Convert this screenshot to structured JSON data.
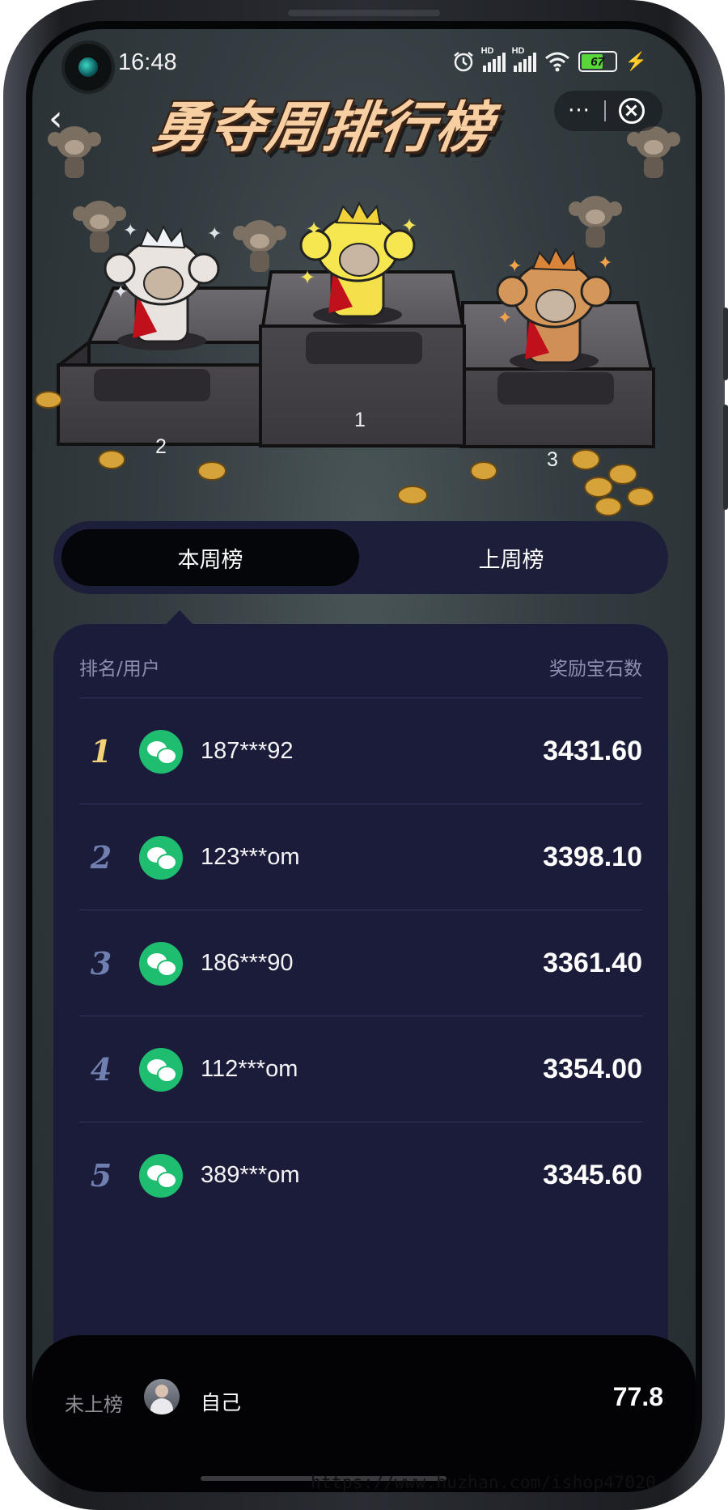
{
  "status_bar": {
    "time": "16:48",
    "hd_label": "HD",
    "battery": "67",
    "icons": [
      "alarm-icon",
      "signal-icon",
      "signal-icon",
      "wifi-icon",
      "battery-icon",
      "charging-icon"
    ]
  },
  "header": {
    "title": "勇夺周排行榜",
    "more_label": "···",
    "back_icon": "‹"
  },
  "podium": {
    "ranks": [
      {
        "label": "2",
        "medal": "silver"
      },
      {
        "label": "1",
        "medal": "gold"
      },
      {
        "label": "3",
        "medal": "bronze"
      }
    ]
  },
  "tabs": {
    "this_week": "本周榜",
    "last_week": "上周榜",
    "active": "this_week"
  },
  "list": {
    "col_rank_user": "排名/用户",
    "col_reward": "奖励宝石数",
    "rows": [
      {
        "rank": "1",
        "user": "187***92",
        "amount": "3431.60"
      },
      {
        "rank": "2",
        "user": "123***om",
        "amount": "3398.10"
      },
      {
        "rank": "3",
        "user": "186***90",
        "amount": "3361.40"
      },
      {
        "rank": "4",
        "user": "112***om",
        "amount": "3354.00"
      },
      {
        "rank": "5",
        "user": "389***om",
        "amount": "3345.60"
      }
    ]
  },
  "my_rank": {
    "status": "未上榜",
    "name": "自己",
    "score": "77.8"
  },
  "watermark": "https://www.huzhan.com/ishop47020",
  "colors": {
    "panel": "#1b1c39",
    "gold_rank": "#f3d277",
    "rank": "#6f7fb0",
    "wechat": "#1ebd70",
    "title": "#f7cfa3"
  }
}
